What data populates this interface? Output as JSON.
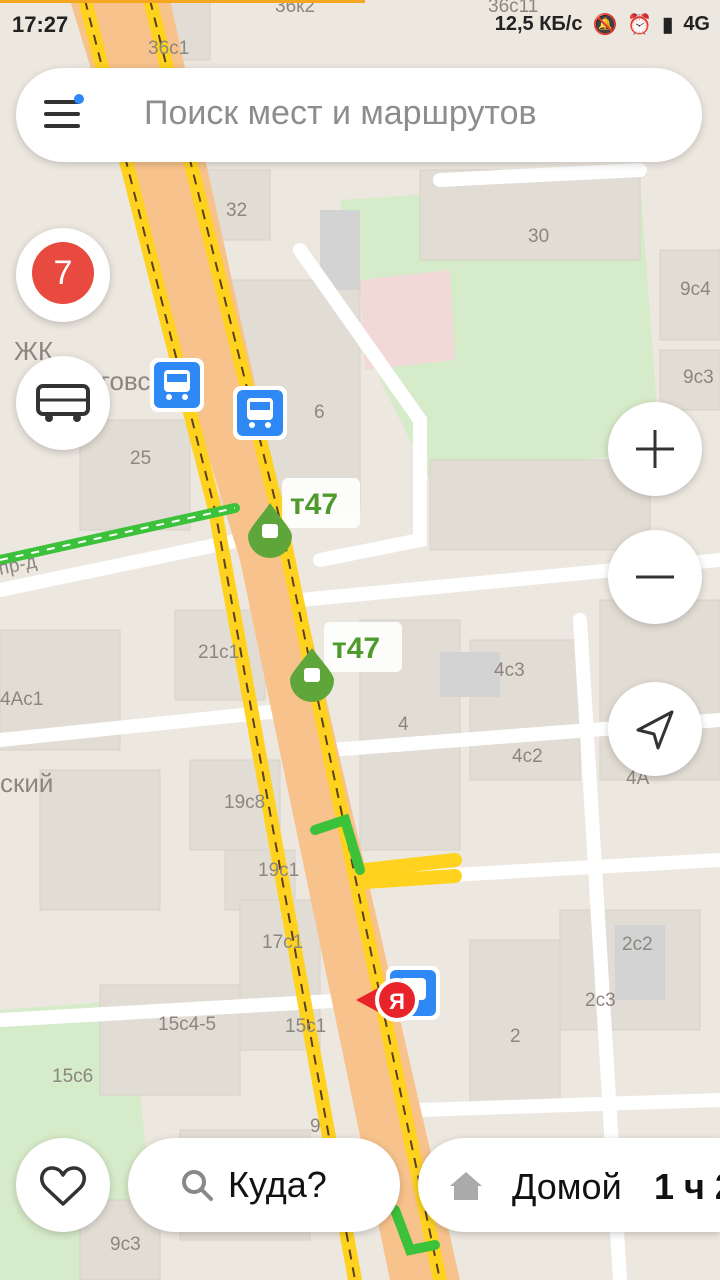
{
  "status_bar": {
    "time": "17:27",
    "speed": "12,5 КБ/с",
    "network": "4G"
  },
  "search": {
    "placeholder": "Поиск мест и маршрутов"
  },
  "traffic": {
    "level": "7"
  },
  "map": {
    "labels": {
      "b36c1": "36с1",
      "b36k2": "36к2",
      "b36c11": "36с11",
      "b32": "32",
      "b30": "30",
      "b9c4": "9с4",
      "b9c3": "9с3",
      "zhk": "ЖК",
      "zhk2": "торговская",
      "b6": "6",
      "b25": "25",
      "street": "пр-д",
      "b21c1": "21с1",
      "b4ac1": "4Ac1",
      "b4c3": "4с3",
      "b4": "4",
      "b4c2": "4с2",
      "b4a": "4А",
      "skiy": "ский",
      "b19c8": "19с8",
      "b19c1": "19с1",
      "b17c1": "17с1",
      "b2c2": "2с2",
      "b2c3": "2с3",
      "b15c45": "15с4-5",
      "b15c1": "15с1",
      "b2": "2",
      "b15c6": "15с6",
      "b9": "9",
      "b9c3b": "9с3"
    },
    "routes": [
      "т47",
      "т47"
    ],
    "me_marker": "Я"
  },
  "bottom": {
    "where_label": "Куда?",
    "home_label": "Домой",
    "home_time": "1 ч 2"
  },
  "colors": {
    "road_fill": "#f7c28c",
    "traffic_yellow": "#ffd21f",
    "traffic_green": "#3cc13b",
    "bus_blue": "#2f89f5",
    "user_red": "#e8232a"
  }
}
